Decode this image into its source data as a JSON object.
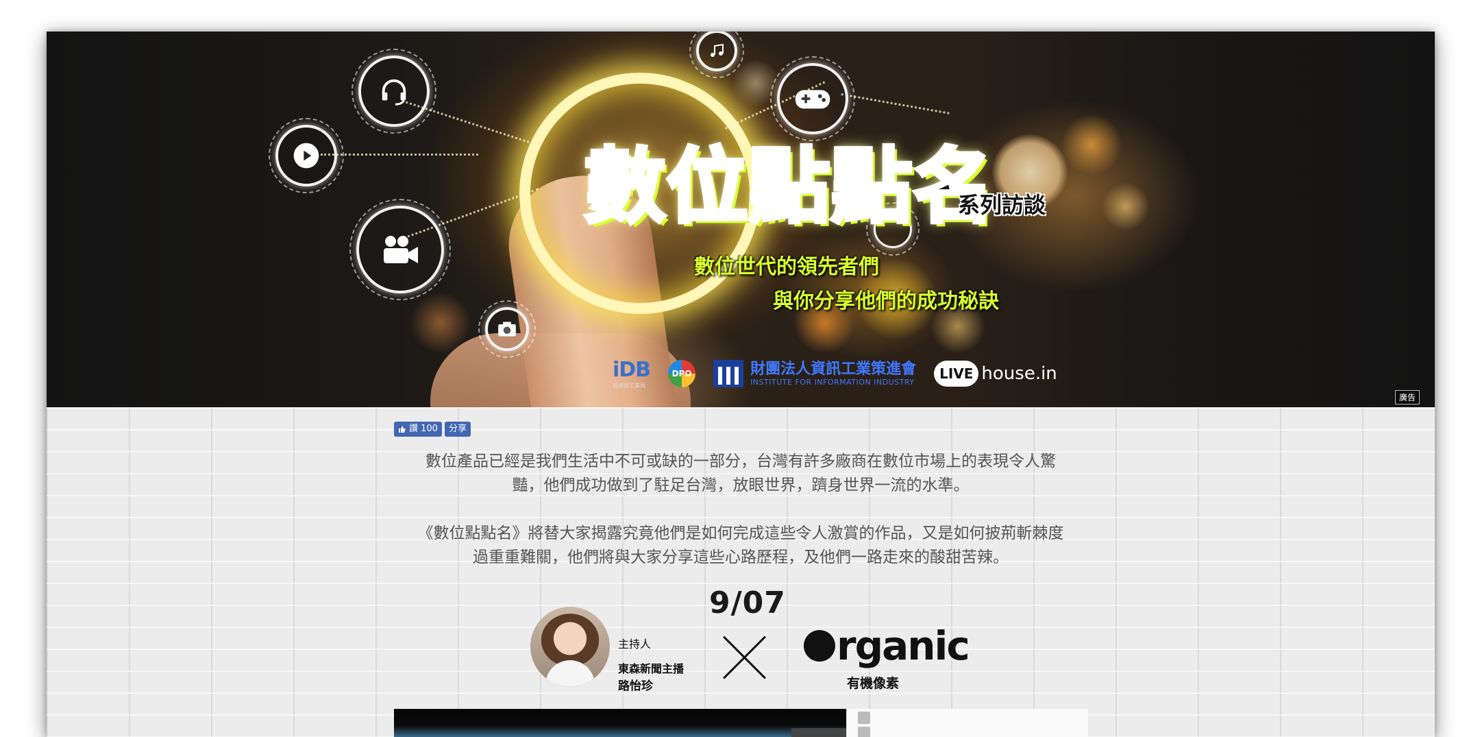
{
  "banner": {
    "title": "數位點點名",
    "subtitle": "系列訪談",
    "slogan_line1": "數位世代的領先者們",
    "slogan_line2": "與你分享他們的成功秘訣",
    "icons": [
      "headset-icon",
      "play-icon",
      "camera-video-icon",
      "photo-camera-icon",
      "gamepad-icon",
      "music-icon"
    ],
    "logos": {
      "idb": "iDB",
      "idb_caption": "經濟部工業局",
      "dpo": "DPO",
      "iii_name": "財團法人資訊工業策進會",
      "iii_english": "INSTITUTE FOR INFORMATION INDUSTRY",
      "live": "LIVE",
      "live_host": "house.in"
    },
    "ad_label": "廣告"
  },
  "social": {
    "like_label": "讚 100",
    "share_label": "分享"
  },
  "description": {
    "paragraph1": "數位產品已經是我們生活中不可或缺的一部分，台灣有許多廠商在數位市場上的表現令人驚豔，他們成功做到了駐足台灣，放眼世界，躋身世界一流的水準。",
    "paragraph2": "《數位點點名》將替大家揭露究竟他們是如何完成這些令人激賞的作品，又是如何披荊斬棘度過重重難關，他們將與大家分享這些心路歷程，及他們一路走來的酸甜苦辣。"
  },
  "episode": {
    "date": "9/07",
    "host_label": "主持人",
    "host_title": "東森新聞主播",
    "host_name": "路怡珍",
    "guest_logo": "rganic",
    "guest_name": "有機像素"
  },
  "colors": {
    "slogan": "#d8ff2a",
    "fb_blue": "#4267b2",
    "wall": "#ececec"
  }
}
